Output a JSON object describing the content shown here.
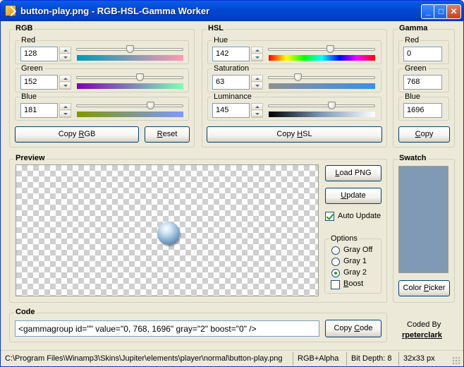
{
  "window": {
    "title": "button-play.png - RGB-HSL-Gamma Worker",
    "minimize": "_",
    "maximize": "□",
    "close": "✕",
    "icon": "app-icon"
  },
  "rgb": {
    "group": "RGB",
    "red_label": "Red",
    "red": "128",
    "red_level": 0.5,
    "green_label": "Green",
    "green": "152",
    "green_level": 0.6,
    "blue_label": "Blue",
    "blue": "181",
    "blue_level": 0.71,
    "copy_prefix": "Copy ",
    "copy_accel": "R",
    "copy_rest": "GB",
    "reset_accel": "R",
    "reset_rest": "eset"
  },
  "hsl": {
    "group": "HSL",
    "hue_label": "Hue",
    "hue": "142",
    "hue_level": 0.59,
    "sat_label": "Saturation",
    "sat": "63",
    "sat_level": 0.26,
    "lum_label": "Luminance",
    "lum": "145",
    "lum_level": 0.6,
    "copy_prefix": "Copy ",
    "copy_accel": "H",
    "copy_rest": "SL"
  },
  "gamma": {
    "group": "Gamma",
    "red_label": "Red",
    "red": "0",
    "green_label": "Green",
    "green": "768",
    "blue_label": "Blue",
    "blue": "1696",
    "copy_accel": "C",
    "copy_rest": "opy"
  },
  "preview": {
    "group": "Preview",
    "load_accel": "L",
    "load_rest": "oad PNG",
    "update_accel": "U",
    "update_rest": "pdate",
    "auto_update": "Auto Update",
    "auto_update_checked": true,
    "options_label": "Options",
    "gray_off": "Gray Off",
    "gray1": "Gray 1",
    "gray2": "Gray 2",
    "selected": "Gray 2",
    "boost_accel": "B",
    "boost_rest": "oost",
    "boost_checked": false
  },
  "swatch": {
    "group": "Swatch",
    "color": "#8099b5",
    "picker_label": "Color ",
    "picker_accel": "P",
    "picker_rest": "icker"
  },
  "code": {
    "group": "Code",
    "value": "<gammagroup id=\"\" value=\"0, 768, 1696\" gray=\"2\" boost=\"0\" />",
    "copy_prefix": "Copy ",
    "copy_accel": "C",
    "copy_rest": "ode"
  },
  "credit": {
    "line1": "Coded By",
    "author": "rpeterclark"
  },
  "status": {
    "path": "C:\\Program Files\\Winamp3\\Skins\\Jupiter\\elements\\player\\normal\\button-play.png",
    "mode": "RGB+Alpha",
    "depth": "Bit Depth: 8",
    "size": "32x33 px"
  }
}
